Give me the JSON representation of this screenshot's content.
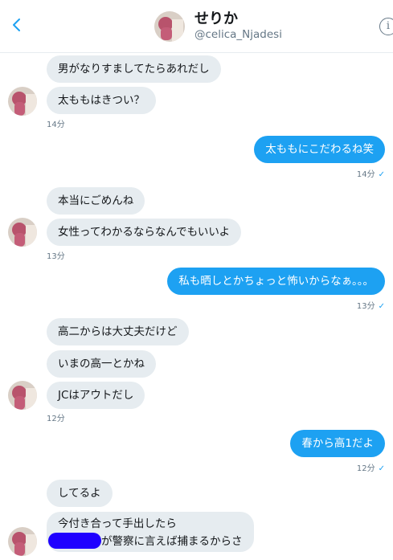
{
  "header": {
    "title": "せりか",
    "handle": "@celica_Njadesi",
    "back_icon": "chevron-left-icon",
    "info_icon": "info-icon"
  },
  "messages": [
    {
      "direction": "in",
      "text": "男がなりすましてたらあれだし"
    },
    {
      "direction": "in",
      "text": "太ももはきつい？"
    },
    {
      "direction": "in",
      "time": "14分"
    },
    {
      "direction": "out",
      "text": "太ももにこだわるね笑",
      "time": "14分"
    },
    {
      "direction": "in",
      "text": "本当にごめんね"
    },
    {
      "direction": "in",
      "text": "女性ってわかるならなんでもいいよ",
      "time": "13分"
    },
    {
      "direction": "out",
      "text": "私も晒しとかちょっと怖いからなぁ。。。",
      "time": "13分"
    },
    {
      "direction": "in",
      "text": "高二からは大丈夫だけど"
    },
    {
      "direction": "in",
      "text": "いまの高一とかね"
    },
    {
      "direction": "in",
      "text": "JCはアウトだし",
      "time": "12分"
    },
    {
      "direction": "out",
      "text": "春から高1だよ",
      "time": "12分"
    },
    {
      "direction": "in",
      "text": "してるよ"
    },
    {
      "direction": "in",
      "text_line1": "今付き合って手出したら",
      "text_line2": "が警察に言えば捕まるからさ"
    }
  ],
  "colors": {
    "outgoing_bubble": "#1da1f2",
    "incoming_bubble": "#e6ecf0",
    "redaction": "#1f00ff",
    "read_check": "#1da1f2"
  },
  "read_indicator": "✓"
}
